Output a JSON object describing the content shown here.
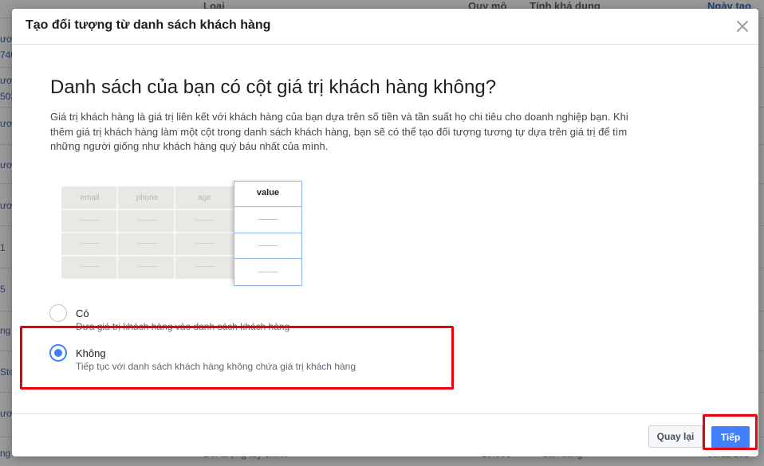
{
  "background": {
    "headers": [
      "Loại",
      "Quy mô",
      "Tính khả dụng",
      "Ngày tạo"
    ],
    "left_cells": [
      "ươ",
      "740",
      "ươ",
      "503",
      "ươ",
      "ươ",
      "ươ",
      "1",
      "5",
      "ng",
      "Sto",
      "ươ",
      "ng fi"
    ],
    "footer": [
      "Đối tượng tùy chỉnh",
      "19.000",
      "Sẵn sàng",
      "09/11/202"
    ]
  },
  "dialog": {
    "title": "Tạo đối tượng từ danh sách khách hàng",
    "headline": "Danh sách của bạn có cột giá trị khách hàng không?",
    "description": "Giá trị khách hàng là giá trị liên kết với khách hàng của bạn dựa trên số tiền và tần suất họ chi tiêu cho doanh nghiệp bạn. Khi thêm giá trị khách hàng làm một cột trong danh sách khách hàng, bạn sẽ có thể tạo đối tượng tương tự dựa trên giá trị để tìm những người giống như khách hàng quý báu nhất của mình.",
    "illustration": {
      "columns": [
        "email",
        "phone",
        "age"
      ],
      "value_column": "value"
    },
    "options": [
      {
        "label": "Có",
        "sub": "Đưa giá trị khách hàng vào danh sách khách hàng",
        "checked": false
      },
      {
        "label": "Không",
        "sub": "Tiếp tục với danh sách khách hàng không chứa giá trị khách hàng",
        "checked": true
      }
    ],
    "buttons": {
      "back": "Quay lại",
      "next": "Tiếp"
    }
  },
  "colors": {
    "accent": "#4080ff",
    "highlight": "#e8000b"
  }
}
